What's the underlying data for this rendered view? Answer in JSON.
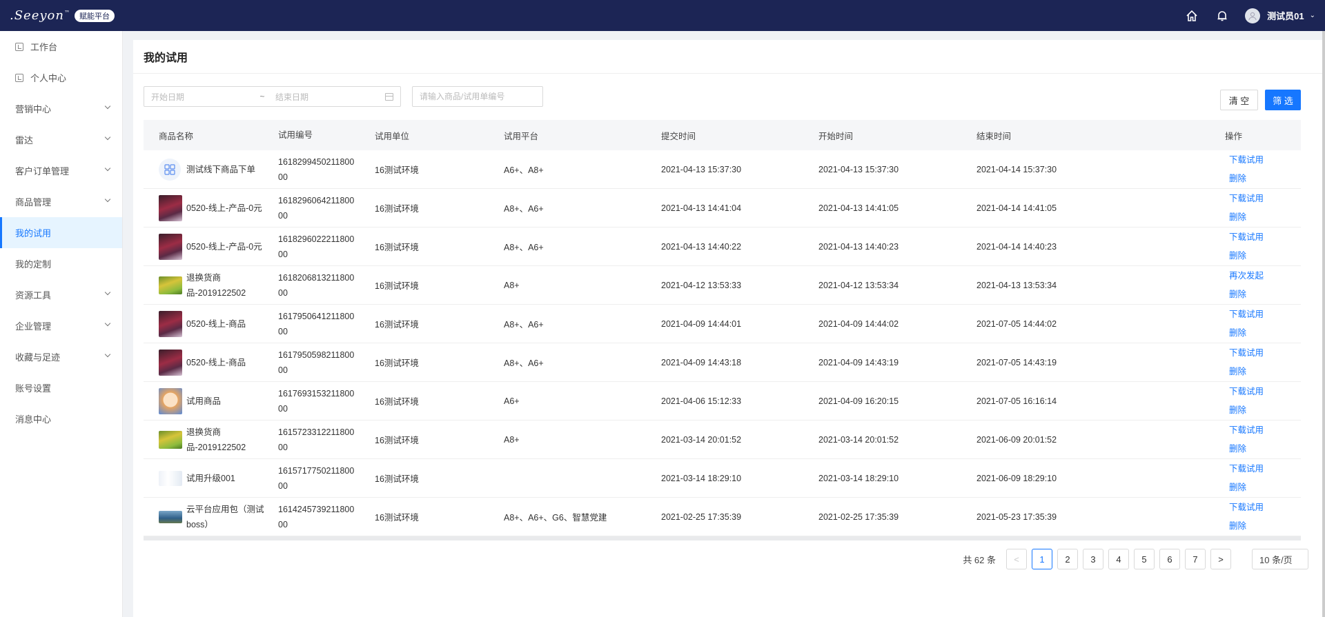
{
  "app": {
    "logo_text": ".Seeyon",
    "logo_tm": "™",
    "badge": "赋能平台"
  },
  "header": {
    "user_name": "测试员01"
  },
  "sidebar": {
    "items": [
      {
        "label": "工作台",
        "icon": "square-icon",
        "arrow": false
      },
      {
        "label": "个人中心",
        "icon": "square-icon",
        "arrow": false
      },
      {
        "label": "营销中心",
        "arrow": true
      },
      {
        "label": "雷达",
        "arrow": true
      },
      {
        "label": "客户订单管理",
        "arrow": true
      },
      {
        "label": "商品管理",
        "arrow": true
      },
      {
        "label": "我的试用",
        "arrow": false,
        "active": true
      },
      {
        "label": "我的定制",
        "arrow": false
      },
      {
        "label": "资源工具",
        "arrow": true
      },
      {
        "label": "企业管理",
        "arrow": true
      },
      {
        "label": "收藏与足迹",
        "arrow": true
      },
      {
        "label": "账号设置",
        "arrow": false
      },
      {
        "label": "消息中心",
        "arrow": false
      }
    ]
  },
  "page": {
    "title": "我的试用"
  },
  "filters": {
    "start_placeholder": "开始日期",
    "separator": "~",
    "end_placeholder": "结束日期",
    "search_placeholder": "请输入商品/试用单编号",
    "clear_label": "清 空",
    "filter_label": "筛 选"
  },
  "table": {
    "headers": [
      "商品名称",
      "试用编号",
      "试用单位",
      "试用平台",
      "提交时间",
      "开始时间",
      "结束时间",
      "操作"
    ],
    "rows": [
      {
        "thumb": "default",
        "name": "测试线下商品下单",
        "code1": "1618299450211800",
        "code2": "00",
        "unit": "16测试环境",
        "platform": "A6+、A8+",
        "submit": "2021-04-13 15:37:30",
        "start": "2021-04-13 15:37:30",
        "end": "2021-04-14 15:37:30",
        "op1": "下载试用",
        "op2": "删除"
      },
      {
        "thumb": "red",
        "name": "0520-线上-产品-0元",
        "code1": "1618296064211800",
        "code2": "00",
        "unit": "16测试环境",
        "platform": "A8+、A6+",
        "submit": "2021-04-13 14:41:04",
        "start": "2021-04-13 14:41:05",
        "end": "2021-04-14 14:41:05",
        "op1": "下载试用",
        "op2": "删除"
      },
      {
        "thumb": "red",
        "name": "0520-线上-产品-0元",
        "code1": "1618296022211800",
        "code2": "00",
        "unit": "16测试环境",
        "platform": "A8+、A6+",
        "submit": "2021-04-13 14:40:22",
        "start": "2021-04-13 14:40:23",
        "end": "2021-04-14 14:40:23",
        "op1": "下载试用",
        "op2": "删除"
      },
      {
        "thumb": "green",
        "name": "退换货商品-2019122502",
        "code1": "1618206813211800",
        "code2": "00",
        "unit": "16测试环境",
        "platform": "A8+",
        "submit": "2021-04-12 13:53:33",
        "start": "2021-04-12 13:53:34",
        "end": "2021-04-13 13:53:34",
        "op1": "再次发起",
        "op2": "删除"
      },
      {
        "thumb": "red",
        "name": "0520-线上-商品",
        "code1": "1617950641211800",
        "code2": "00",
        "unit": "16测试环境",
        "platform": "A8+、A6+",
        "submit": "2021-04-09 14:44:01",
        "start": "2021-04-09 14:44:02",
        "end": "2021-07-05 14:44:02",
        "op1": "下载试用",
        "op2": "删除"
      },
      {
        "thumb": "red",
        "name": "0520-线上-商品",
        "code1": "1617950598211800",
        "code2": "00",
        "unit": "16测试环境",
        "platform": "A8+、A6+",
        "submit": "2021-04-09 14:43:18",
        "start": "2021-04-09 14:43:19",
        "end": "2021-07-05 14:43:19",
        "op1": "下载试用",
        "op2": "删除"
      },
      {
        "thumb": "anime",
        "name": "试用商品",
        "code1": "1617693153211800",
        "code2": "00",
        "unit": "16测试环境",
        "platform": "A6+",
        "submit": "2021-04-06 15:12:33",
        "start": "2021-04-09 16:20:15",
        "end": "2021-07-05 16:16:14",
        "op1": "下载试用",
        "op2": "删除"
      },
      {
        "thumb": "green",
        "name": "退换货商品-2019122502",
        "code1": "1615723312211800",
        "code2": "00",
        "unit": "16测试环境",
        "platform": "A8+",
        "submit": "2021-03-14 20:01:52",
        "start": "2021-03-14 20:01:52",
        "end": "2021-06-09 20:01:52",
        "op1": "下载试用",
        "op2": "删除"
      },
      {
        "thumb": "blank",
        "name": "试用升级001",
        "code1": "1615717750211800",
        "code2": "00",
        "unit": "16测试环境",
        "platform": "",
        "submit": "2021-03-14 18:29:10",
        "start": "2021-03-14 18:29:10",
        "end": "2021-06-09 18:29:10",
        "op1": "下载试用",
        "op2": "删除"
      },
      {
        "thumb": "sky",
        "name": "云平台应用包（测试boss）",
        "code1": "1614245739211800",
        "code2": "00",
        "unit": "16测试环境",
        "platform": "A8+、A6+、G6、智慧党建",
        "submit": "2021-02-25 17:35:39",
        "start": "2021-02-25 17:35:39",
        "end": "2021-05-23 17:35:39",
        "op1": "下载试用",
        "op2": "删除"
      }
    ]
  },
  "pagination": {
    "total_label": "共 62 条",
    "prev": "<",
    "pages": [
      "1",
      "2",
      "3",
      "4",
      "5",
      "6",
      "7"
    ],
    "current": "1",
    "next": ">",
    "page_size": "10 条/页"
  }
}
